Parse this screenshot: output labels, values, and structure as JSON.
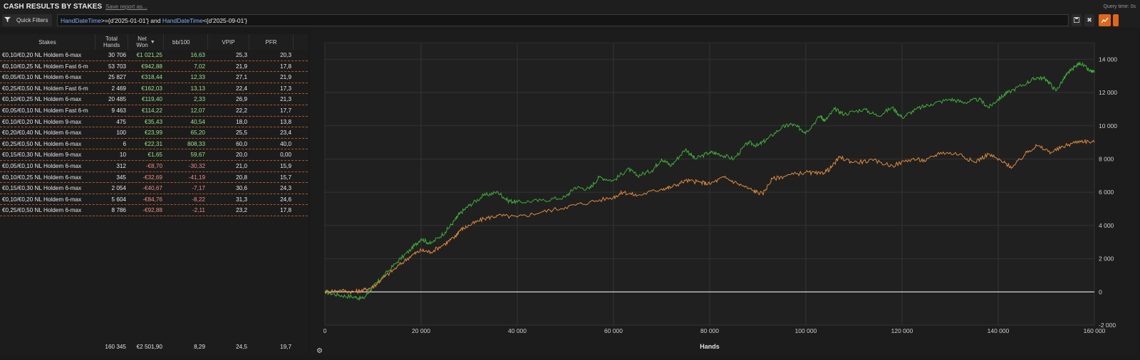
{
  "header": {
    "title": "CASH RESULTS BY STAKES",
    "save_report": "Save report as...",
    "query_time": "Query time: 0s"
  },
  "filters": {
    "quick_filters_label": "Quick Filters",
    "expression": {
      "kw1": "HandDateTime",
      "op1": ">=",
      "val1": "{d'2025-01-01'}",
      "join": " and ",
      "kw2": "HandDateTime",
      "op2": "<",
      "val2": "{d'2025-09-01'}"
    }
  },
  "icons": {
    "filter": "funnel-icon",
    "save": "save-icon",
    "close": "close-icon",
    "chart": "line-chart-icon",
    "settings": "gear-icon"
  },
  "colors": {
    "positive": "#9ee08c",
    "negative": "#f08a8a",
    "accent": "#e0661c",
    "net_won_line": "#3fae3a",
    "allin_ev_line": "#e08a3c"
  },
  "table": {
    "columns": {
      "stakes": "Stakes",
      "hands_l1": "Total",
      "hands_l2": "Hands",
      "net_l1": "Net",
      "net_l2": "Won",
      "bb": "bb/100",
      "vpip": "VPIP",
      "pfr": "PFR"
    },
    "rows": [
      {
        "stakes": "€0,10/€0,20 NL Holdem 6-max",
        "hands": "30 706",
        "net": "€1 021,25",
        "bb": "16,63",
        "vpip": "25,3",
        "pfr": "20,3",
        "sign": "pos"
      },
      {
        "stakes": "€0,10/€0,25 NL Holdem Fast 6-m",
        "hands": "53 703",
        "net": "€942,88",
        "bb": "7,02",
        "vpip": "21,9",
        "pfr": "17,8",
        "sign": "pos"
      },
      {
        "stakes": "€0,05/€0,10 NL Holdem 6-max",
        "hands": "25 827",
        "net": "€318,44",
        "bb": "12,33",
        "vpip": "27,1",
        "pfr": "21,9",
        "sign": "pos"
      },
      {
        "stakes": "€0,25/€0,50 NL Holdem Fast 6-m",
        "hands": "2 469",
        "net": "€162,03",
        "bb": "13,13",
        "vpip": "22,4",
        "pfr": "17,3",
        "sign": "pos"
      },
      {
        "stakes": "€0,10/€0,25 NL Holdem 6-max",
        "hands": "20 485",
        "net": "€119,40",
        "bb": "2,33",
        "vpip": "26,9",
        "pfr": "21,3",
        "sign": "pos"
      },
      {
        "stakes": "€0,05/€0,10 NL Holdem Fast 6-m",
        "hands": "9 463",
        "net": "€114,22",
        "bb": "12,07",
        "vpip": "22,2",
        "pfr": "17,7",
        "sign": "pos"
      },
      {
        "stakes": "€0,10/€0,20 NL Holdem 9-max",
        "hands": "475",
        "net": "€35,43",
        "bb": "40,54",
        "vpip": "18,0",
        "pfr": "13,8",
        "sign": "pos"
      },
      {
        "stakes": "€0,20/€0,40 NL Holdem 6-max",
        "hands": "100",
        "net": "€23,99",
        "bb": "65,20",
        "vpip": "25,5",
        "pfr": "23,4",
        "sign": "pos"
      },
      {
        "stakes": "€0,25/€0,50 NL Holdem 6-max",
        "hands": "6",
        "net": "€22,31",
        "bb": "808,33",
        "vpip": "60,0",
        "pfr": "40,0",
        "sign": "pos"
      },
      {
        "stakes": "€0,15/€0,30 NL Holdem 9-max",
        "hands": "10",
        "net": "€1,65",
        "bb": "59,67",
        "vpip": "20,0",
        "pfr": "0,00",
        "sign": "pos"
      },
      {
        "stakes": "€0,05/€0,10 NL Holdem 6-max",
        "hands": "312",
        "net": "-€8,70",
        "bb": "-30,32",
        "vpip": "21,0",
        "pfr": "15,9",
        "sign": "neg"
      },
      {
        "stakes": "€0,10/€0,25 NL Holdem 6-max",
        "hands": "345",
        "net": "-€32,69",
        "bb": "-41,19",
        "vpip": "20,8",
        "pfr": "15,7",
        "sign": "neg"
      },
      {
        "stakes": "€0,15/€0,30 NL Holdem 6-max",
        "hands": "2 054",
        "net": "-€40,67",
        "bb": "-7,17",
        "vpip": "30,6",
        "pfr": "24,3",
        "sign": "neg"
      },
      {
        "stakes": "€0,10/€0,20 NL Holdem 6-max",
        "hands": "5 604",
        "net": "-€84,76",
        "bb": "-8,22",
        "vpip": "31,3",
        "pfr": "24,6",
        "sign": "neg"
      },
      {
        "stakes": "€0,25/€0,50 NL Holdem 6-max",
        "hands": "8 786",
        "net": "-€92,88",
        "bb": "-2,11",
        "vpip": "23,2",
        "pfr": "17,8",
        "sign": "neg"
      }
    ],
    "totals": {
      "hands": "160 345",
      "net": "€2 501,90",
      "bb": "8,29",
      "vpip": "24,5",
      "pfr": "19,7"
    }
  },
  "chart_data": {
    "type": "line",
    "xlabel": "Hands",
    "xlim": [
      0,
      160000
    ],
    "ylim": [
      -2000,
      15000
    ],
    "x_ticks": [
      0,
      20000,
      40000,
      60000,
      80000,
      100000,
      120000,
      140000,
      160000
    ],
    "x_tick_labels": [
      "0",
      "20 000",
      "40 000",
      "60 000",
      "80 000",
      "100 000",
      "120 000",
      "140 000",
      "160 000"
    ],
    "y_ticks": [
      -2000,
      0,
      2000,
      4000,
      6000,
      8000,
      10000,
      12000,
      14000
    ],
    "y_tick_labels": [
      "-2 000",
      "0",
      "2 000",
      "4 000",
      "6 000",
      "8 000",
      "10 000",
      "12 000",
      "14 000"
    ],
    "grid": true,
    "zero_line": true,
    "series": [
      {
        "color": "#3fae3a",
        "x": [
          0,
          3000,
          6000,
          8000,
          10000,
          12000,
          15000,
          18000,
          20000,
          22000,
          25000,
          27000,
          28000,
          30000,
          33000,
          36000,
          38000,
          40000,
          45000,
          50000,
          52000,
          55000,
          57000,
          60000,
          63000,
          65000,
          68000,
          70000,
          72000,
          75000,
          77000,
          80000,
          82000,
          85000,
          88000,
          90000,
          92000,
          95000,
          97000,
          99000,
          100000,
          103000,
          104000,
          106000,
          108000,
          112000,
          115000,
          118000,
          120000,
          123000,
          126000,
          130000,
          133000,
          136000,
          138000,
          140000,
          142000,
          146000,
          148000,
          150000,
          152000,
          154000,
          155000,
          157000,
          159000,
          160000
        ],
        "y": [
          0,
          -200,
          -300,
          -400,
          300,
          900,
          1800,
          2600,
          3200,
          2900,
          3600,
          4300,
          4700,
          5200,
          5800,
          6000,
          5500,
          5400,
          5500,
          5700,
          6300,
          6200,
          6900,
          6700,
          7400,
          7000,
          7300,
          8000,
          7600,
          8600,
          8000,
          8400,
          8300,
          8000,
          9000,
          8800,
          9200,
          9900,
          10100,
          9800,
          9600,
          10600,
          10300,
          11000,
          10700,
          11000,
          10600,
          11100,
          10500,
          11000,
          11300,
          11600,
          11400,
          11600,
          11100,
          11600,
          12000,
          12600,
          12900,
          12800,
          12100,
          13000,
          13300,
          13800,
          13300,
          13200
        ]
      },
      {
        "color": "#e08a3c",
        "x": [
          0,
          3000,
          6000,
          8000,
          10000,
          12000,
          15000,
          18000,
          20000,
          22000,
          25000,
          27000,
          28000,
          30000,
          33000,
          36000,
          40000,
          45000,
          50000,
          55000,
          60000,
          62000,
          65000,
          70000,
          72000,
          75000,
          78000,
          80000,
          83000,
          86000,
          89000,
          91000,
          93000,
          96000,
          100000,
          103000,
          105000,
          107000,
          110000,
          114000,
          118000,
          122000,
          125000,
          128000,
          132000,
          135000,
          138000,
          141000,
          143000,
          146000,
          148000,
          151000,
          154000,
          157000,
          160000
        ],
        "y": [
          0,
          100,
          0,
          100,
          300,
          800,
          1500,
          2200,
          2500,
          2400,
          2900,
          3300,
          3700,
          4000,
          4400,
          4600,
          4500,
          4800,
          5100,
          5400,
          5700,
          6000,
          5800,
          6200,
          6300,
          6700,
          6600,
          6500,
          6900,
          6500,
          6100,
          5900,
          6800,
          7000,
          7200,
          7100,
          7400,
          8100,
          7800,
          7900,
          7600,
          8000,
          7900,
          8400,
          8300,
          7800,
          8300,
          7800,
          7500,
          8400,
          8800,
          8400,
          8800,
          9100,
          9000
        ]
      }
    ]
  }
}
